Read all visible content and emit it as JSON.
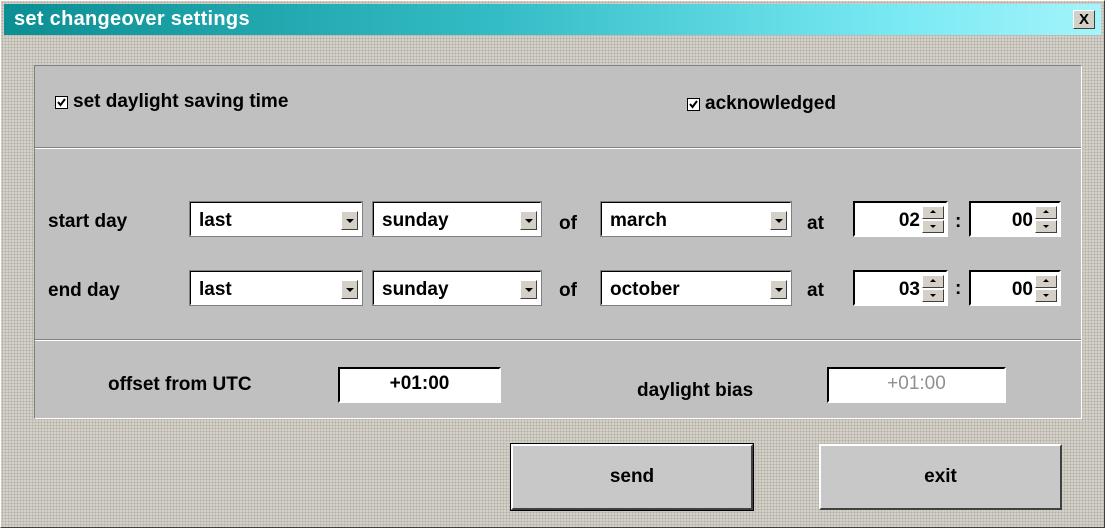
{
  "window": {
    "title": "set changeover settings",
    "close_label": "X"
  },
  "checkboxes": {
    "set_dst": {
      "label": "set daylight saving time",
      "checked": true
    },
    "acknowledged": {
      "label": "acknowledged",
      "checked": true
    }
  },
  "start_row": {
    "label": "start day",
    "ordinal": "last",
    "weekday": "sunday",
    "of_label": "of",
    "month": "march",
    "at_label": "at",
    "hour": "02",
    "colon": ":",
    "minute": "00"
  },
  "end_row": {
    "label": "end day",
    "ordinal": "last",
    "weekday": "sunday",
    "of_label": "of",
    "month": "october",
    "at_label": "at",
    "hour": "03",
    "colon": ":",
    "minute": "00"
  },
  "offset": {
    "label": "offset from UTC",
    "value": "+01:00"
  },
  "bias": {
    "label": "daylight bias",
    "value": "+01:00"
  },
  "buttons": {
    "send": "send",
    "exit": "exit"
  },
  "colors": {
    "title_gradient_start": "#0c8f93",
    "title_gradient_end": "#a4f4fb",
    "panel": "#c0c0c0"
  }
}
